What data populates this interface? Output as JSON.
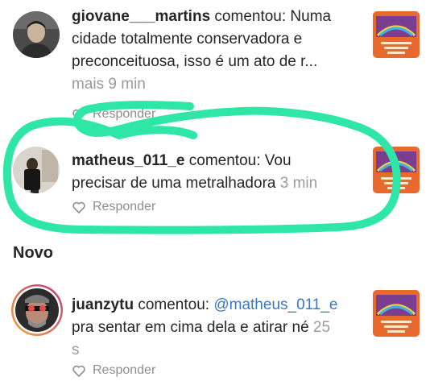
{
  "notifications": [
    {
      "username": "giovane___martins",
      "action": " comentou: ",
      "comment_lines": [
        "Numa",
        "cidade totalmente conservadora e",
        "preconceituosa, isso é um ato de r..."
      ],
      "time": "mais 9 min",
      "reply_label": "Responder"
    },
    {
      "username": "matheus_011_e",
      "action": " comentou: ",
      "comment_lines": [
        "Vou",
        "precisar de uma metralhadora"
      ],
      "time": "3 min",
      "reply_label": "Responder"
    },
    {
      "username": "juanzytu",
      "action": " comentou: ",
      "mention": "@matheus_011_e",
      "comment_lines": [
        "pra sentar em cima dela e atirar né"
      ],
      "time_line1": "25",
      "time_line2": "s",
      "reply_label": "Responder"
    }
  ],
  "section_new": "Novo",
  "icons": {
    "heart": "heart-outline-icon",
    "post_thumb": "post-thumbnail"
  },
  "colors": {
    "highlight": "#2ee6a6",
    "time": "#9a9a9a",
    "mention": "#3a78c2",
    "thumb_orange": "#e9692c",
    "story_ring_start": "#f8a43a",
    "story_ring_end": "#c1357f"
  }
}
